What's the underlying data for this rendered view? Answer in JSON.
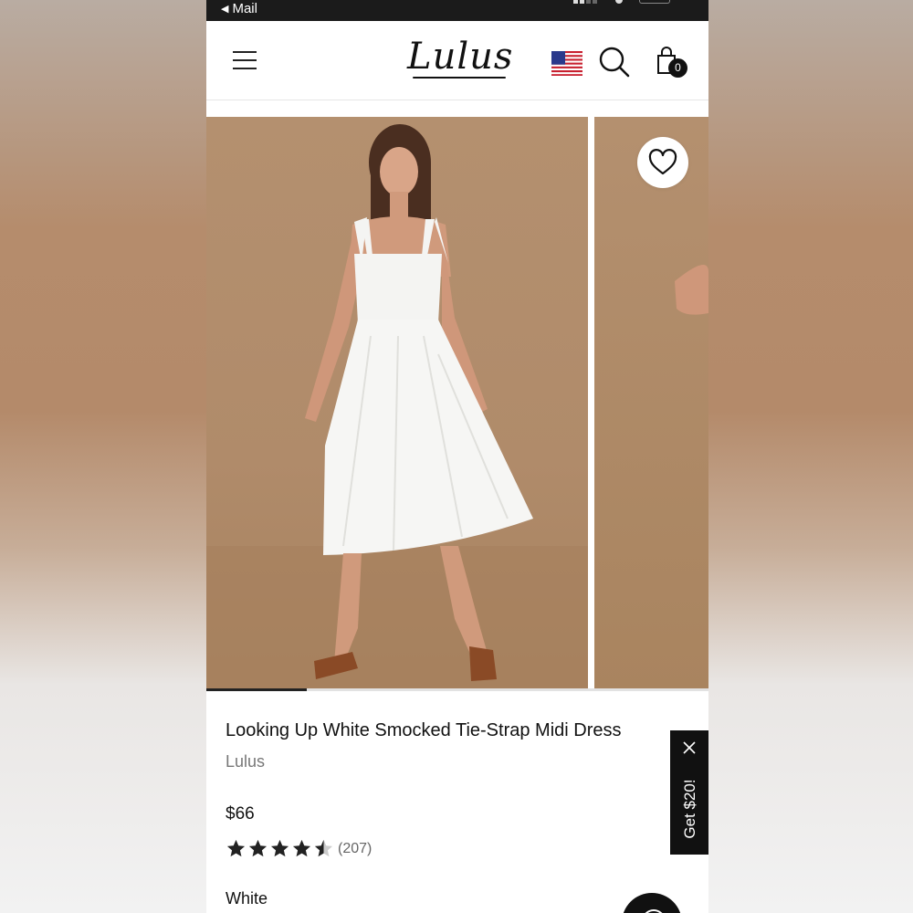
{
  "status_bar": {
    "back_label": "Mail"
  },
  "header": {
    "logo_text": "Lulus",
    "cart_count": "0"
  },
  "gallery": {
    "slide_progress": 0.2
  },
  "product": {
    "title": "Looking Up White Smocked Tie-Strap Midi Dress",
    "brand": "Lulus",
    "price": "$66",
    "rating": 4.5,
    "rating_count": "(207)",
    "selected_color": "White"
  },
  "promo": {
    "label": "Get $20!"
  },
  "colors": {
    "accent": "#111111",
    "photo_bg": "#b08b6a"
  }
}
